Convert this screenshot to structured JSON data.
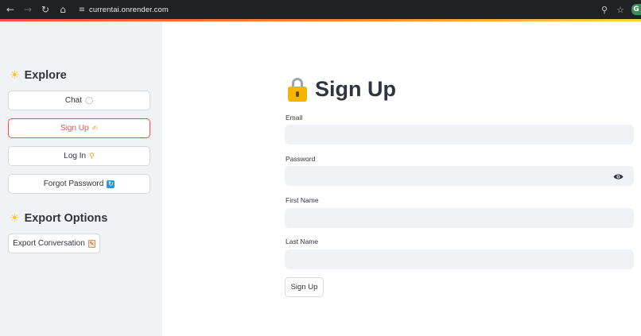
{
  "browser": {
    "url": "currentai.onrender.com",
    "icons": [
      "back-icon",
      "forward-icon",
      "reload-icon",
      "home-icon",
      "site-settings-icon",
      "key-icon",
      "bookmark-star-icon",
      "extension-icon"
    ],
    "extension_letter": "G"
  },
  "theme": {
    "accent": "#ff4b4b",
    "sidebar_bg": "#f0f2f6",
    "input_bg": "#f0f2f6"
  },
  "sidebar": {
    "explore_title": "Explore",
    "items": [
      {
        "label": "Chat",
        "icon": "speech-bubble-icon",
        "glyph": "💬",
        "active": false
      },
      {
        "label": "Sign Up",
        "icon": "writing-hand-icon",
        "glyph": "✍",
        "active": true
      },
      {
        "label": "Log In",
        "icon": "key-icon",
        "glyph": "🔑",
        "active": false
      },
      {
        "label": "Forgot Password",
        "icon": "refresh-icon",
        "glyph": "🔄",
        "active": false
      }
    ],
    "export_title": "Export Options",
    "export_button": {
      "label": "Export Conversation",
      "icon": "memo-icon",
      "glyph": "📝"
    }
  },
  "main": {
    "title": "Sign Up",
    "title_icon": "lock-icon",
    "fields": [
      {
        "label": "Email",
        "value": "",
        "type": "text"
      },
      {
        "label": "Password",
        "value": "",
        "type": "password"
      },
      {
        "label": "First Name",
        "value": "",
        "type": "text"
      },
      {
        "label": "Last Name",
        "value": "",
        "type": "text"
      }
    ],
    "submit_label": "Sign Up"
  }
}
